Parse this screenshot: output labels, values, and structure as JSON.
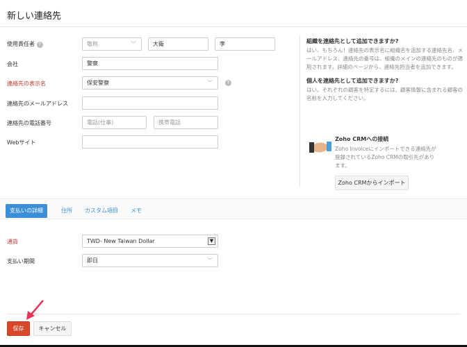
{
  "page_title": "新しい連絡先",
  "form": {
    "contact_person": {
      "label": "使用責任者",
      "salutation": "敬称",
      "first_name": "大衛",
      "last_name": "李"
    },
    "company": {
      "label": "会社",
      "value": "警察"
    },
    "display_name": {
      "label": "連絡先の表示名",
      "value": "保安警察"
    },
    "email": {
      "label": "連絡先のメールアドレス",
      "value": ""
    },
    "phone": {
      "label": "連絡先の電話番号",
      "work_placeholder": "電話(仕事)",
      "mobile_placeholder": "携帯電話"
    },
    "website": {
      "label": "Webサイト",
      "value": ""
    }
  },
  "help_panel": {
    "q1": "組織を連絡先として追加できますか?",
    "a1": "はい、もちろん！連絡先の表示名に組織名を追加する連絡先名、メールアドレス、連絡先の番号は、組織のメインの連絡先のものが適用されます。詳細のページから、連絡先担当者を追加できます。",
    "q2": "個人を連絡先として追加できますか?",
    "a2": "はい。それぞれの顧客を特定するには、顧客情報に含まれる顧客の名前を入力してください。",
    "crm_title": "Zoho CRMへの接続",
    "crm_text": "Zoho Invoiceにインポートできる連絡先が登録されているZoho CRMの取引先があります。",
    "crm_button": "Zoho CRMからインポート"
  },
  "tabs": [
    {
      "label": "支払いの詳細",
      "active": true
    },
    {
      "label": "住所"
    },
    {
      "label": "カスタム項目"
    },
    {
      "label": "メモ"
    }
  ],
  "payment": {
    "currency": {
      "label": "通貨",
      "value": "TWD- New Taiwan Dollar"
    },
    "terms": {
      "label": "支払い期間",
      "value": "即日"
    }
  },
  "footer": {
    "save": "保存",
    "cancel": "キャンセル"
  },
  "colors": {
    "accent": "#3a8fd8",
    "save": "#d9472b",
    "required": "#c0392b",
    "arrow": "#e8335a"
  }
}
